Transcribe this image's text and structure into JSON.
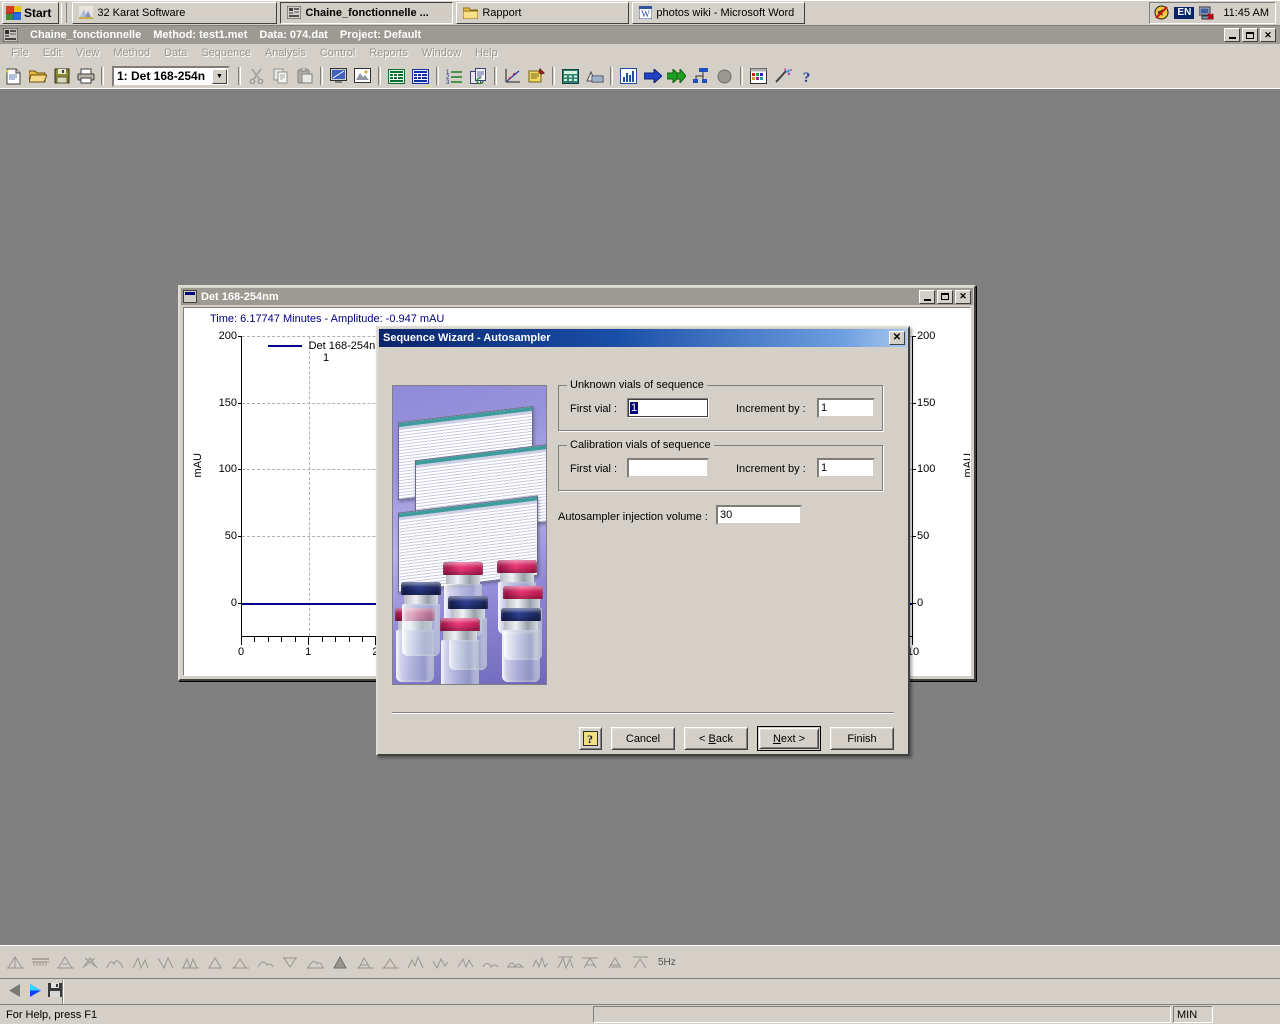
{
  "taskbar": {
    "start_label": "Start",
    "buttons": [
      {
        "label": "32 Karat Software",
        "icon": "karat-app-icon",
        "active": false
      },
      {
        "label": "Chaine_fonctionnelle  ...",
        "icon": "chromatogram-icon",
        "active": true
      },
      {
        "label": "Rapport",
        "icon": "folder-icon",
        "active": false
      },
      {
        "label": "photos wiki - Microsoft Word",
        "icon": "word-icon",
        "active": false
      }
    ],
    "tray": {
      "volume_icon": "volume-muted-icon",
      "language": "EN",
      "network_icon": "network-disconnected-icon",
      "clock": "11:45 AM"
    }
  },
  "app": {
    "title": "Chaine_fonctionnelle",
    "method": "Method: test1.met",
    "data": "Data: 074.dat",
    "project": "Project: Default",
    "window_icon": "instrument-icon",
    "controls": {
      "minimize": "_",
      "maximize": "❐",
      "close": "✕"
    },
    "menu": [
      "File",
      "Edit",
      "View",
      "Method",
      "Data",
      "Sequence",
      "Analysis",
      "Control",
      "Reports",
      "Window",
      "Help"
    ],
    "toolbar": {
      "channel_combo_value": "1: Det 168-254n",
      "items": [
        "new-file-icon",
        "open-folder-icon",
        "save-disk-icon",
        "print-icon",
        "sep",
        "channel-combo",
        "sep",
        "cut-scissors-icon",
        "copy-icon",
        "paste-icon",
        "sep",
        "monitor-icon",
        "picture-icon",
        "sep",
        "green-table-icon",
        "blue-table-icon",
        "sep",
        "list-numbered-icon",
        "copy-method-icon",
        "sep",
        "calibration-plot-icon",
        "method-notes-icon",
        "sep",
        "calculator-icon",
        "integration-icon",
        "sep",
        "bar-chart-icon",
        "blue-arrow-icon",
        "double-green-arrow-icon",
        "routing-icon",
        "stop-circle-icon",
        "sep",
        "colored-grid-icon",
        "wand-icon",
        "help-question-icon"
      ]
    }
  },
  "chart_window": {
    "title": "Det 168-254nm",
    "controls": {
      "minimize": "_",
      "maximize": "❐",
      "close": "✕"
    },
    "readout": "Time:  6.17747 Minutes - Amplitude:  -0.947 mAU"
  },
  "chart_data": {
    "type": "line",
    "title": "Det 168-254nm",
    "xlabel": "",
    "ylabel": "mAU",
    "right_ylabel": "mAU",
    "legend": {
      "position": "top-center",
      "entries": [
        {
          "name": "Det 168-254nm",
          "channel": "1",
          "color": "#00008b"
        }
      ]
    },
    "grid": true,
    "xlim": [
      0,
      10
    ],
    "ylim": [
      -25,
      200
    ],
    "yticks": [
      0,
      50,
      100,
      150,
      200
    ],
    "ytick_labels": [
      "0",
      "50",
      "100",
      "150",
      "200"
    ],
    "right_yticks": [
      0,
      50,
      100,
      150,
      200
    ],
    "right_ytick_labels": [
      "0",
      "50",
      "100",
      "150",
      "200"
    ],
    "xticks": [
      0,
      1,
      2,
      10
    ],
    "xtick_labels": [
      "0",
      "1",
      "2",
      "10"
    ],
    "series": [
      {
        "name": "Det 168-254nm",
        "color": "#00008b",
        "x": [
          0,
          10
        ],
        "y": [
          0,
          0
        ]
      }
    ]
  },
  "wizard": {
    "title": "Sequence Wizard - Autosampler",
    "close_label": "✕",
    "artwork_name": "autosampler-vials-photo",
    "unknown_group": {
      "legend": "Unknown vials of sequence",
      "first_vial_label": "First vial :",
      "first_vial_value": "1",
      "first_vial_selected": true,
      "increment_label": "Increment by :",
      "increment_value": "1"
    },
    "calibration_group": {
      "legend": "Calibration vials of sequence",
      "first_vial_label": "First vial :",
      "first_vial_value": "",
      "increment_label": "Increment by :",
      "increment_value": "1"
    },
    "injection": {
      "label": "Autosampler injection volume :",
      "value": "30"
    },
    "buttons": {
      "help": "?",
      "cancel": "Cancel",
      "back_pre": "< ",
      "back_key": "B",
      "back_post": "ack",
      "next_key": "N",
      "next_post": "ext >",
      "finish": "Finish"
    }
  },
  "bottom": {
    "peak_toolbar_hz": "5Hz",
    "peak_icon_count": 26,
    "play_icons": [
      "previous-triangle-icon",
      "play-triangle-icon",
      "save-disk-icon"
    ],
    "status_text": "For Help, press F1",
    "status_unit": "MIN"
  }
}
